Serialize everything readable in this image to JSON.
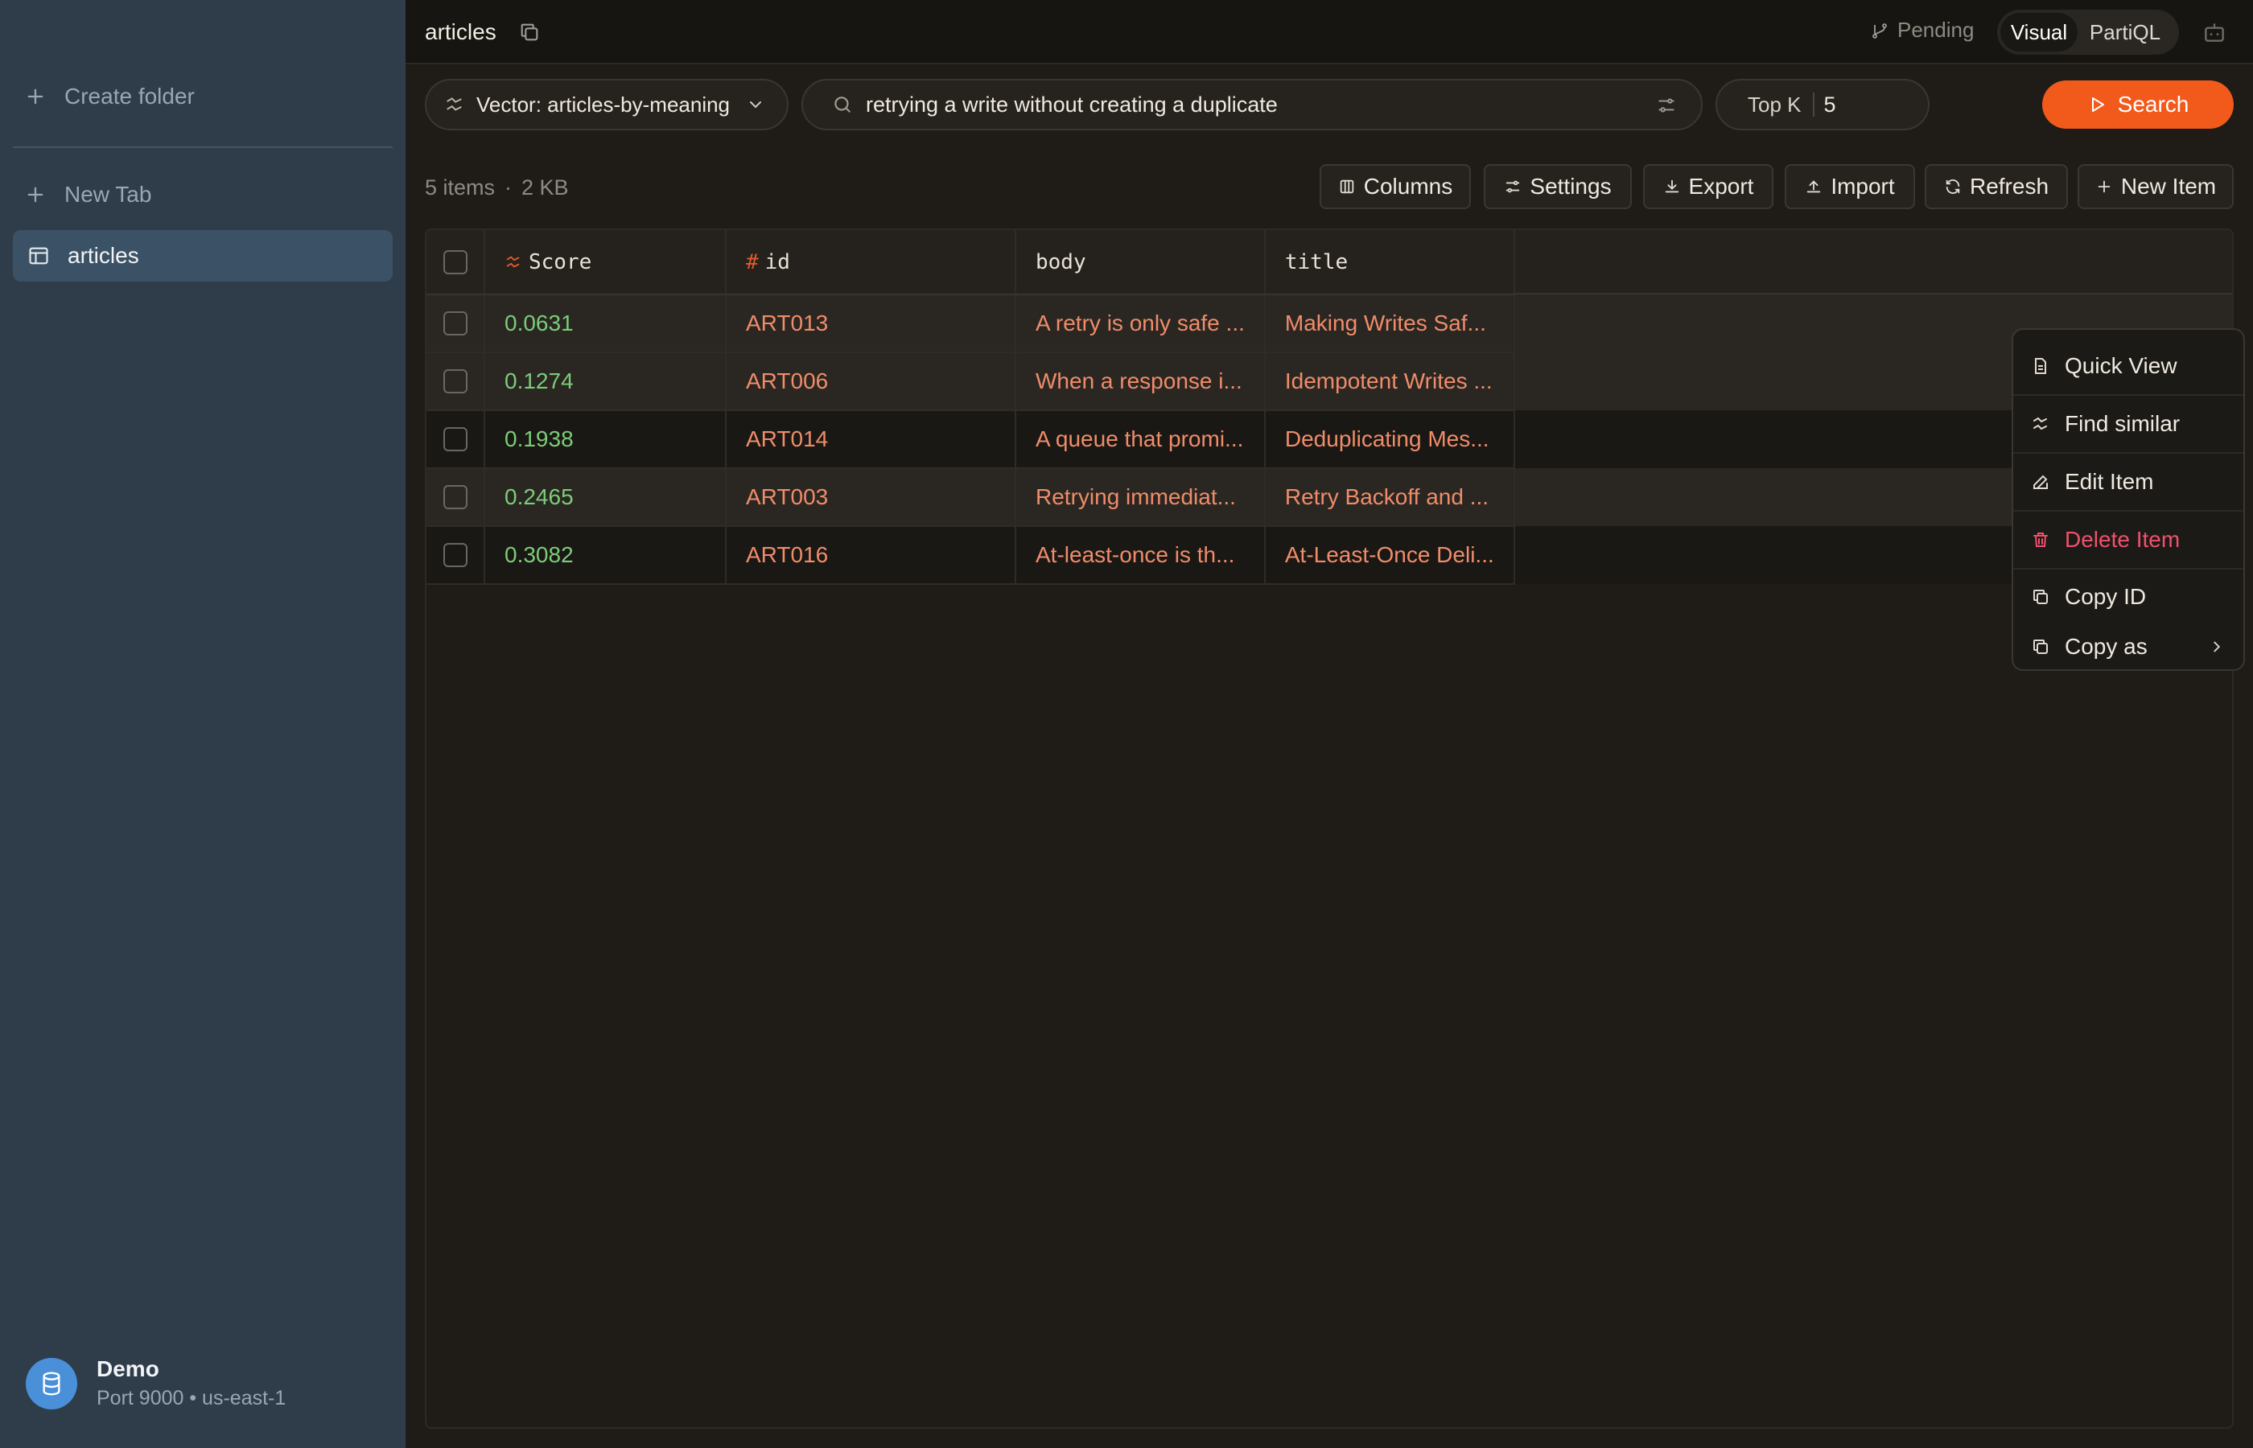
{
  "sidebar": {
    "create_folder": "Create folder",
    "new_tab": "New Tab",
    "active_item": "articles",
    "profile": {
      "name": "Demo",
      "details": "Port 9000 • us-east-1"
    }
  },
  "topbar": {
    "tab_title": "articles",
    "pending": "Pending",
    "modes": [
      "Visual",
      "PartiQL"
    ],
    "active_mode": "Visual"
  },
  "query": {
    "index_label": "Vector: articles-by-meaning",
    "search_value": "retrying a write without creating a duplicate",
    "topk_label": "Top K",
    "topk_value": "5",
    "search_button": "Search"
  },
  "toolbar": {
    "item_count": "5 items",
    "size": "2 KB",
    "separator": "·",
    "columns": "Columns",
    "settings": "Settings",
    "export": "Export",
    "import": "Import",
    "refresh": "Refresh",
    "new_item": "New Item"
  },
  "table": {
    "headers": [
      "Score",
      "id",
      "body",
      "title"
    ],
    "rows": [
      {
        "score": "0.0631",
        "id": "ART013",
        "body": "A retry is only safe ...",
        "title": "Making Writes Saf..."
      },
      {
        "score": "0.1274",
        "id": "ART006",
        "body": "When a response i...",
        "title": "Idempotent Writes ..."
      },
      {
        "score": "0.1938",
        "id": "ART014",
        "body": "A queue that promi...",
        "title": "Deduplicating Mes..."
      },
      {
        "score": "0.2465",
        "id": "ART003",
        "body": "Retrying immediat...",
        "title": "Retry Backoff and ..."
      },
      {
        "score": "0.3082",
        "id": "ART016",
        "body": "At-least-once is th...",
        "title": "At-Least-Once Deli..."
      }
    ]
  },
  "context_menu": {
    "quick_view": "Quick View",
    "find_similar": "Find similar",
    "edit_item": "Edit Item",
    "delete_item": "Delete Item",
    "copy_id": "Copy ID",
    "copy_as": "Copy as"
  },
  "colors": {
    "accent": "#f25a1c",
    "score": "#7ccc78",
    "value": "#f08c6a",
    "danger": "#f0506e",
    "sidebar": "#2f3d4b"
  }
}
